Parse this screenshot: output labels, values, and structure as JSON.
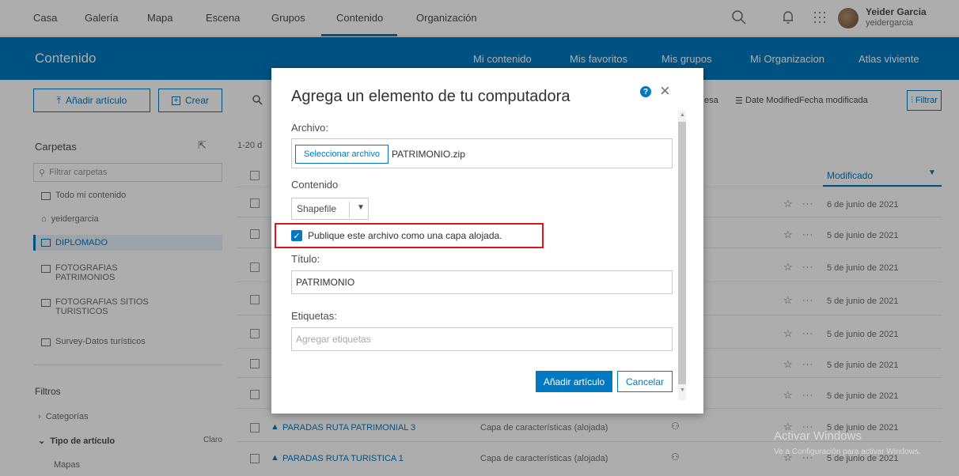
{
  "topnav": {
    "items": [
      "Casa",
      "Galería",
      "Mapa",
      "Escena",
      "Grupos",
      "Contenido",
      "Organización"
    ],
    "user_name": "Yeider Garcia",
    "user_login": "yeidergarcia",
    "icons": [
      "search-icon",
      "bell-icon",
      "apps-grid-icon"
    ]
  },
  "header": {
    "title": "Contenido",
    "tabs": [
      "Mi contenido",
      "Mis favoritos",
      "Mis grupos",
      "Mi Organizacion",
      "Atlas viviente"
    ]
  },
  "toolbar": {
    "add_item": "Añadir artículo",
    "create": "Crear",
    "partial_label": "esa",
    "sort_label": "Date ModifiedFecha modificada",
    "filter_label": "Filtrar"
  },
  "sidebar": {
    "folders_heading": "Carpetas",
    "filter_placeholder": "Filtrar carpetas",
    "folders": [
      "Todo mi contenido",
      "yeidergarcia",
      "DIPLOMADO",
      "FOTOGRAFIAS PATRIMONIOS",
      "FOTOGRAFIAS SITIOS TURISTICOS",
      "Survey-Datos turísticos"
    ],
    "filters_heading": "Filtros",
    "categories": "Categorías",
    "item_type": "Tipo de artículo",
    "clear": "Claro",
    "maps": "Mapas"
  },
  "list": {
    "count_partial": "1-20 d",
    "modified_header": "Modificado",
    "dates": [
      "6 de junio de 2021",
      "5 de junio de 2021",
      "5 de junio de 2021",
      "5 de junio de 2021",
      "5 de junio de 2021",
      "5 de junio de 2021",
      "5 de junio de 2021",
      "5 de junio de 2021",
      "5 de junio de 2021"
    ],
    "rows": [
      {
        "name": "PARADAS RUTA PATRIMONIAL 3",
        "type": "Capa de características (alojada)"
      },
      {
        "name": "PARADAS RUTA TURISTICA 1",
        "type": "Capa de características (alojada)"
      }
    ]
  },
  "modal": {
    "title": "Agrega un elemento de tu computadora",
    "file_label": "Archivo:",
    "select_file": "Seleccionar archivo",
    "file_name": "PATRIMONIO.zip",
    "content_label": "Contenido",
    "content_value": "Shapefile",
    "publish_label": "Publique este archivo como una capa alojada.",
    "publish_checked": true,
    "title_label": "Título:",
    "title_value": "PATRIMONIO",
    "tags_label": "Etiquetas:",
    "tags_placeholder": "Agregar etiquetas",
    "add_button": "Añadir artículo",
    "cancel_button": "Cancelar",
    "highlight_color": "#e0141e"
  },
  "watermark": {
    "line1": "Activar Windows",
    "line2": "Ve a Configuración para activar Windows."
  },
  "colors": {
    "accent": "#0079c1"
  }
}
